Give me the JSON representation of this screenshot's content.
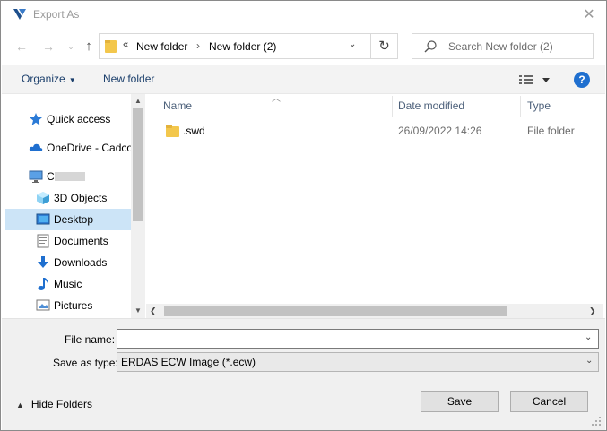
{
  "window": {
    "title": "Export As",
    "close_label": "✕"
  },
  "navigation": {
    "back_label": "←",
    "forward_label": "→",
    "recent_label": "⌄",
    "up_label": "↑",
    "address_overflow": "«",
    "breadcrumbs": [
      "New folder",
      "New folder (2)"
    ],
    "breadcrumb_separator": "›",
    "refresh_label": "↻"
  },
  "search": {
    "placeholder": "Search New folder (2)"
  },
  "toolbar": {
    "organize_label": "Organize",
    "new_folder_label": "New folder",
    "help_label": "?"
  },
  "nav_pane": {
    "items": [
      {
        "label": "Quick access",
        "icon": "star-icon"
      },
      {
        "label": "OneDrive - Cadco",
        "icon": "cloud-icon"
      },
      {
        "label": "C",
        "icon": "computer-icon"
      },
      {
        "label": "3D Objects",
        "icon": "cube-icon"
      },
      {
        "label": "Desktop",
        "icon": "desktop-icon",
        "selected": true
      },
      {
        "label": "Documents",
        "icon": "document-icon"
      },
      {
        "label": "Downloads",
        "icon": "download-icon"
      },
      {
        "label": "Music",
        "icon": "music-icon"
      },
      {
        "label": "Pictures",
        "icon": "pictures-icon"
      }
    ]
  },
  "file_list": {
    "columns": [
      "Name",
      "Date modified",
      "Type"
    ],
    "rows": [
      {
        "name": ".swd",
        "date_modified": "26/09/2022 14:26",
        "type": "File folder"
      }
    ]
  },
  "save_panel": {
    "file_name_label": "File name:",
    "file_name_value": "",
    "save_as_type_label": "Save as type:",
    "save_as_type_value": "ERDAS ECW Image (*.ecw)",
    "hide_folders_label": "Hide Folders",
    "save_label": "Save",
    "cancel_label": "Cancel"
  },
  "colors": {
    "accent": "#1f6fcf",
    "selection": "#cce4f7",
    "folder": "#f3c74c",
    "link_text": "#1a3e6b"
  }
}
